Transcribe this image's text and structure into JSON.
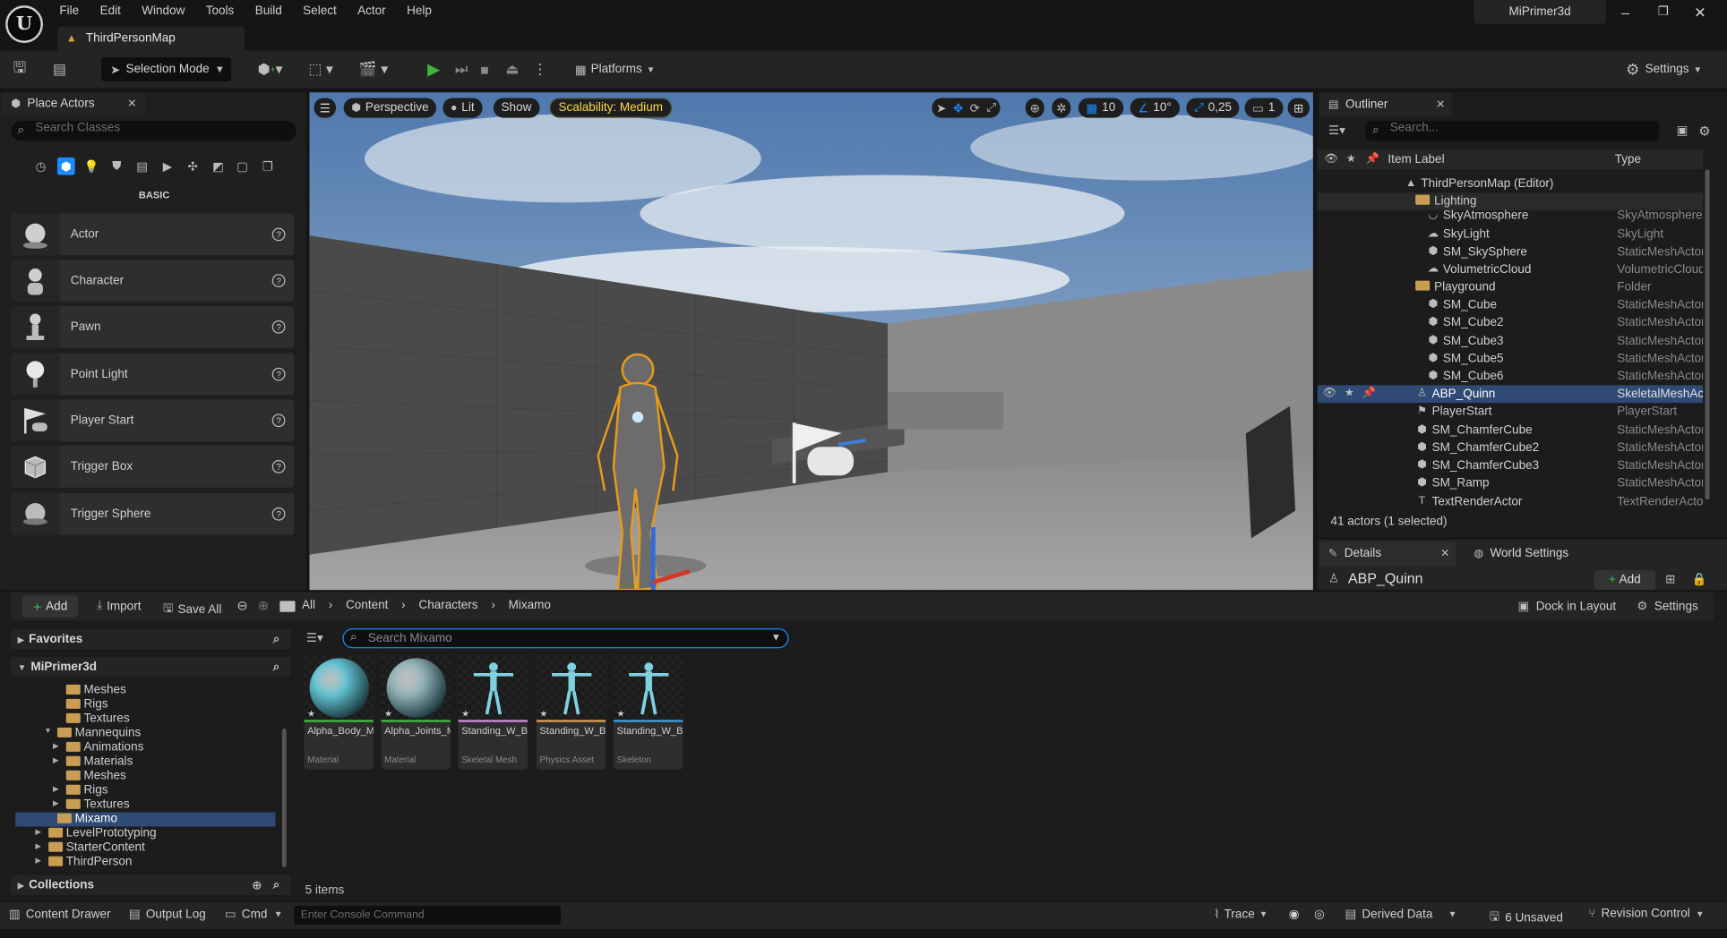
{
  "menu": [
    "File",
    "Edit",
    "Window",
    "Tools",
    "Build",
    "Select",
    "Actor",
    "Help"
  ],
  "map_tab": "ThirdPersonMap",
  "project_name": "MiPrimer3d",
  "toolbar": {
    "selection_mode": "Selection Mode",
    "platforms": "Platforms",
    "settings": "Settings"
  },
  "place_actors": {
    "title": "Place Actors",
    "search_placeholder": "Search Classes",
    "category": "BASIC",
    "items": [
      "Actor",
      "Character",
      "Pawn",
      "Point Light",
      "Player Start",
      "Trigger Box",
      "Trigger Sphere"
    ]
  },
  "viewport": {
    "perspective": "Perspective",
    "lit": "Lit",
    "show": "Show",
    "scalability": "Scalability: Medium",
    "grid": "10",
    "angle": "10°",
    "scale": "0,25",
    "camera": "1"
  },
  "outliner": {
    "title": "Outliner",
    "search_placeholder": "Search...",
    "col_label": "Item Label",
    "col_type": "Type",
    "rows": [
      {
        "name": "ThirdPersonMap (Editor)",
        "type": ""
      },
      {
        "name": "Lighting",
        "type": ""
      },
      {
        "name": "SkyAtmosphere",
        "type": "SkyAtmosphere"
      },
      {
        "name": "SkyLight",
        "type": "SkyLight"
      },
      {
        "name": "SM_SkySphere",
        "type": "StaticMeshActor"
      },
      {
        "name": "VolumetricCloud",
        "type": "VolumetricCloud"
      },
      {
        "name": "Playground",
        "type": "Folder"
      },
      {
        "name": "SM_Cube",
        "type": "StaticMeshActor"
      },
      {
        "name": "SM_Cube2",
        "type": "StaticMeshActor"
      },
      {
        "name": "SM_Cube3",
        "type": "StaticMeshActor"
      },
      {
        "name": "SM_Cube5",
        "type": "StaticMeshActor"
      },
      {
        "name": "SM_Cube6",
        "type": "StaticMeshActor"
      },
      {
        "name": "ABP_Quinn",
        "type": "SkeletalMeshActor"
      },
      {
        "name": "PlayerStart",
        "type": "PlayerStart"
      },
      {
        "name": "SM_ChamferCube",
        "type": "StaticMeshActor"
      },
      {
        "name": "SM_ChamferCube2",
        "type": "StaticMeshActor"
      },
      {
        "name": "SM_ChamferCube3",
        "type": "StaticMeshActor"
      },
      {
        "name": "SM_Ramp",
        "type": "StaticMeshActor"
      },
      {
        "name": "TextRenderActor",
        "type": "TextRenderActor"
      }
    ],
    "count": "41 actors (1 selected)"
  },
  "details": {
    "tab": "Details",
    "world_settings": "World Settings",
    "actor": "ABP_Quinn",
    "add": "Add"
  },
  "content_browser": {
    "add": "Add",
    "import": "Import",
    "save_all": "Save All",
    "path": [
      "All",
      "Content",
      "Characters",
      "Mixamo"
    ],
    "dock": "Dock in Layout",
    "settings": "Settings",
    "favorites": "Favorites",
    "project": "MiPrimer3d",
    "collections": "Collections",
    "search_placeholder": "Search Mixamo",
    "tree": [
      {
        "label": "Meshes",
        "indent": 1,
        "arrow": false
      },
      {
        "label": "Rigs",
        "indent": 1,
        "arrow": false
      },
      {
        "label": "Textures",
        "indent": 1,
        "arrow": false
      },
      {
        "label": "Mannequins",
        "indent": 0,
        "arrow": "open"
      },
      {
        "label": "Animations",
        "indent": 1,
        "arrow": "closed"
      },
      {
        "label": "Materials",
        "indent": 1,
        "arrow": "closed"
      },
      {
        "label": "Meshes",
        "indent": 1,
        "arrow": false
      },
      {
        "label": "Rigs",
        "indent": 1,
        "arrow": "closed"
      },
      {
        "label": "Textures",
        "indent": 1,
        "arrow": "closed"
      },
      {
        "label": "Mixamo",
        "indent": 0,
        "arrow": false
      },
      {
        "label": "LevelPrototyping",
        "indent": -1,
        "arrow": "closed"
      },
      {
        "label": "StarterContent",
        "indent": -1,
        "arrow": "closed"
      },
      {
        "label": "ThirdPerson",
        "indent": -1,
        "arrow": "closed"
      }
    ],
    "assets": [
      {
        "name": "Alpha_Body_MAT",
        "type": "Material",
        "color": "#5fc0d0",
        "bar": "#3fbf3f"
      },
      {
        "name": "Alpha_Joints_MAT",
        "type": "Material",
        "color": "#8fb0b4",
        "bar": "#3fbf3f"
      },
      {
        "name": "Standing_W_Briefcase_Idle",
        "type": "Skeletal Mesh",
        "color": "#7fd0e0",
        "bar": "#d48fe0"
      },
      {
        "name": "Standing_W_Briefcase_Idle_PhysicsAsset",
        "type": "Physics Asset",
        "color": "#7fd0e0",
        "bar": "#e0a050"
      },
      {
        "name": "Standing_W_Briefcase_Idle_Skeleton",
        "type": "Skeleton",
        "color": "#7fd0e0",
        "bar": "#40a0e0"
      }
    ],
    "item_count": "5 items"
  },
  "status": {
    "content_drawer": "Content Drawer",
    "output_log": "Output Log",
    "cmd": "Cmd",
    "console_placeholder": "Enter Console Command",
    "trace": "Trace",
    "derived_data": "Derived Data",
    "unsaved": "6 Unsaved",
    "revision": "Revision Control"
  },
  "colors": {
    "accent": "#1a8cff",
    "selection": "#2f4a74",
    "folder": "#c99e52"
  }
}
